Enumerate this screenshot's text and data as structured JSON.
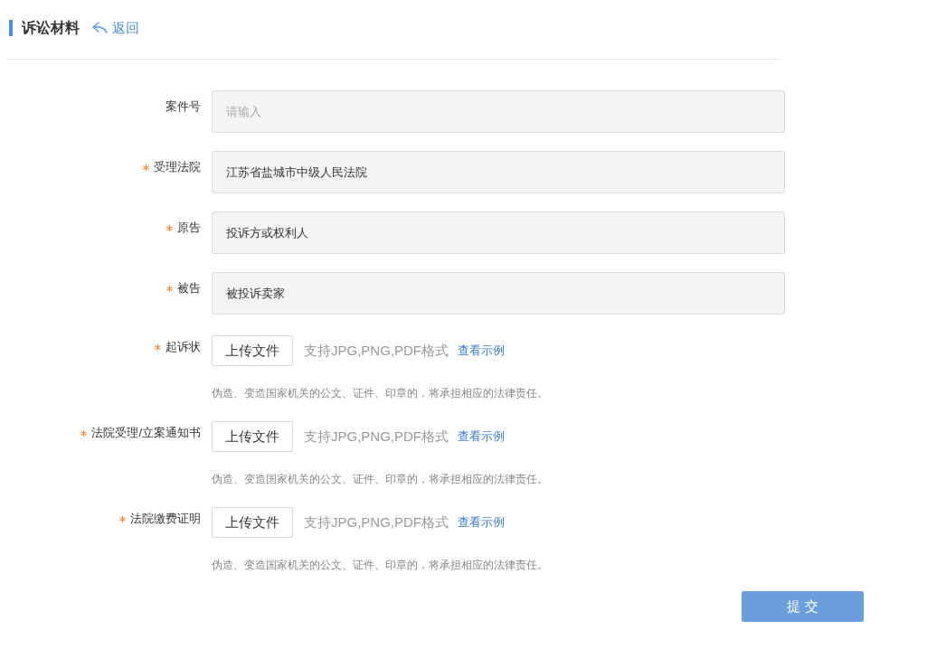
{
  "header": {
    "title": "诉讼材料",
    "back_link": "返回"
  },
  "fields": [
    {
      "kind": "text",
      "label": "案件号",
      "required": false,
      "placeholder": "请输入"
    },
    {
      "kind": "text",
      "label": "受理法院",
      "required": true,
      "value": "江苏省盐城市中级人民法院"
    },
    {
      "kind": "text",
      "label": "原告",
      "required": true,
      "value": "投诉方或权利人"
    },
    {
      "kind": "text",
      "label": "被告",
      "required": true,
      "value": "被投诉卖家"
    },
    {
      "kind": "upload",
      "label": "起诉状",
      "required": true,
      "button": "上传文件",
      "formats": "支持JPG,PNG,PDF格式",
      "example_link": "查看示例",
      "warning": "伪造、变造国家机关的公文、证件、印章的，将承担相应的法律责任。"
    },
    {
      "kind": "upload",
      "label": "法院受理/立案通知书",
      "required": true,
      "button": "上传文件",
      "formats": "支持JPG,PNG,PDF格式",
      "example_link": "查看示例",
      "warning": "伪造、变造国家机关的公文、证件、印章的，将承担相应的法律责任。"
    },
    {
      "kind": "upload",
      "label": "法院缴费证明",
      "required": true,
      "button": "上传文件",
      "formats": "支持JPG,PNG,PDF格式",
      "example_link": "查看示例",
      "warning": "伪造、变造国家机关的公文、证件、印章的，将承担相应的法律责任。"
    }
  ],
  "submit_button": "提 交"
}
